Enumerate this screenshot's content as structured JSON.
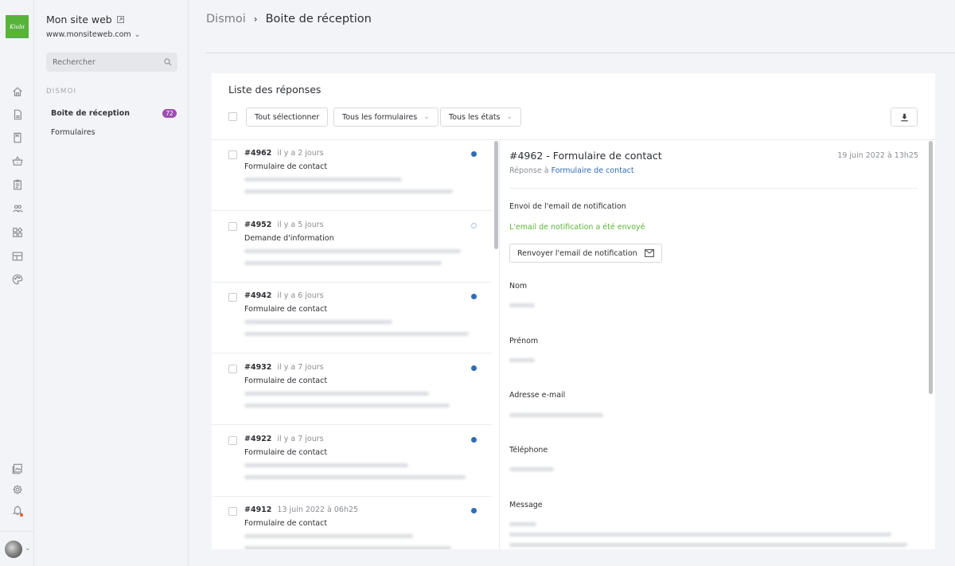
{
  "rail": {
    "logo_text": "Kiubi",
    "icons": [
      "home-icon",
      "page-icon",
      "book-icon",
      "basket-icon",
      "clipboard-icon",
      "users-icon",
      "modules-icon",
      "layout-icon",
      "palette-icon"
    ],
    "bottom_icons": [
      "media-icon",
      "gear-icon",
      "bell-icon"
    ]
  },
  "sidebar": {
    "site_title": "Mon site web",
    "site_url": "www.monsiteweb.com",
    "search_placeholder": "Rechercher",
    "section_label": "DISMOI",
    "items": [
      {
        "label": "Boite de réception",
        "badge": "72",
        "active": true
      },
      {
        "label": "Formulaires"
      }
    ]
  },
  "breadcrumb": {
    "root": "Dismoi",
    "separator": "›",
    "current": "Boite de réception"
  },
  "list": {
    "title": "Liste des réponses",
    "select_all_label": "Tout sélectionner",
    "forms_filter": "Tous les formulaires",
    "states_filter": "Tous les états",
    "rows": [
      {
        "id": "#4962",
        "time": "il y a 2 jours",
        "form": "Formulaire de contact",
        "unread": true
      },
      {
        "id": "#4952",
        "time": "il y a 5 jours",
        "form": "Demande d'information",
        "unread": false
      },
      {
        "id": "#4942",
        "time": "il y a 6 jours",
        "form": "Formulaire de contact",
        "unread": true
      },
      {
        "id": "#4932",
        "time": "il y a 7 jours",
        "form": "Formulaire de contact",
        "unread": true
      },
      {
        "id": "#4922",
        "time": "il y a 7 jours",
        "form": "Formulaire de contact",
        "unread": true
      },
      {
        "id": "#4912",
        "time": "13 juin 2022 à 06h25",
        "form": "Formulaire de contact",
        "unread": true
      }
    ]
  },
  "detail": {
    "title": "#4962 - Formulaire de contact",
    "date": "19 juin 2022 à 13h25",
    "reply_prefix": "Réponse à",
    "reply_link": "Formulaire de contact",
    "notification_heading": "Envoi de l'email de notification",
    "notification_status": "L'email de notification a été envoyé",
    "resend_label": "Renvoyer l'email de notification",
    "fields": [
      "Nom",
      "Prénom",
      "Adresse e-mail",
      "Téléphone",
      "Message"
    ]
  },
  "colors": {
    "brand_green": "#58b33a",
    "badge_purple": "#9b4fb0",
    "unread_blue": "#2e6db4",
    "success_green": "#5cb437"
  }
}
